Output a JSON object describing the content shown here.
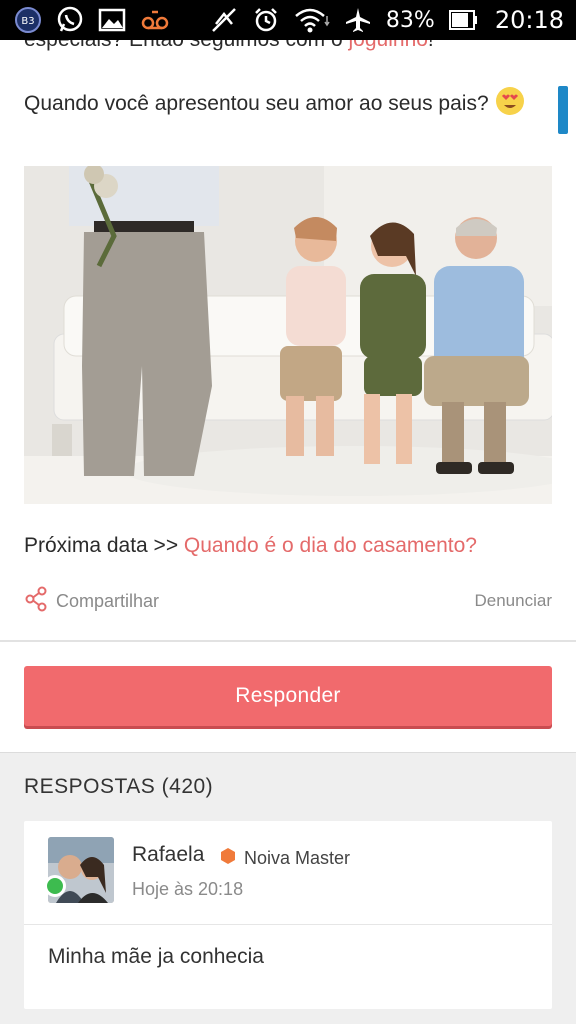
{
  "status_bar": {
    "battery": "83%",
    "time": "20:18",
    "notification_badge": "B3",
    "icons": [
      "b3-badge-icon",
      "whatsapp-icon",
      "gallery-icon",
      "voicemail-icon",
      "mute-icon",
      "alarm-icon",
      "wifi-icon",
      "airplane-icon",
      "battery-icon"
    ]
  },
  "post": {
    "cut_line_prefix": "especiais? Então seguimos com o ",
    "cut_line_link": "joguinho",
    "cut_line_suffix": "!",
    "question": "Quando você apresentou seu amor ao seus pais?",
    "emoji": "heart-eyes-emoji",
    "photo_alt": "photo",
    "next_prefix": "Próxima data >> ",
    "next_link": "Quando é o dia do casamento?",
    "share_label": "Compartilhar",
    "report_label": "Denunciar"
  },
  "reply": {
    "button_label": "Responder"
  },
  "answers": {
    "title": "RESPOSTAS (420)",
    "items": [
      {
        "name": "Rafaela",
        "badge": "Noiva Master",
        "time": "Hoje às 20:18",
        "text": "Minha mãe ja conhecia"
      }
    ]
  },
  "colors": {
    "accent": "#f16a6d",
    "link": "#e46a6a",
    "online": "#3dbb4f",
    "badge": "#f07a3a"
  }
}
